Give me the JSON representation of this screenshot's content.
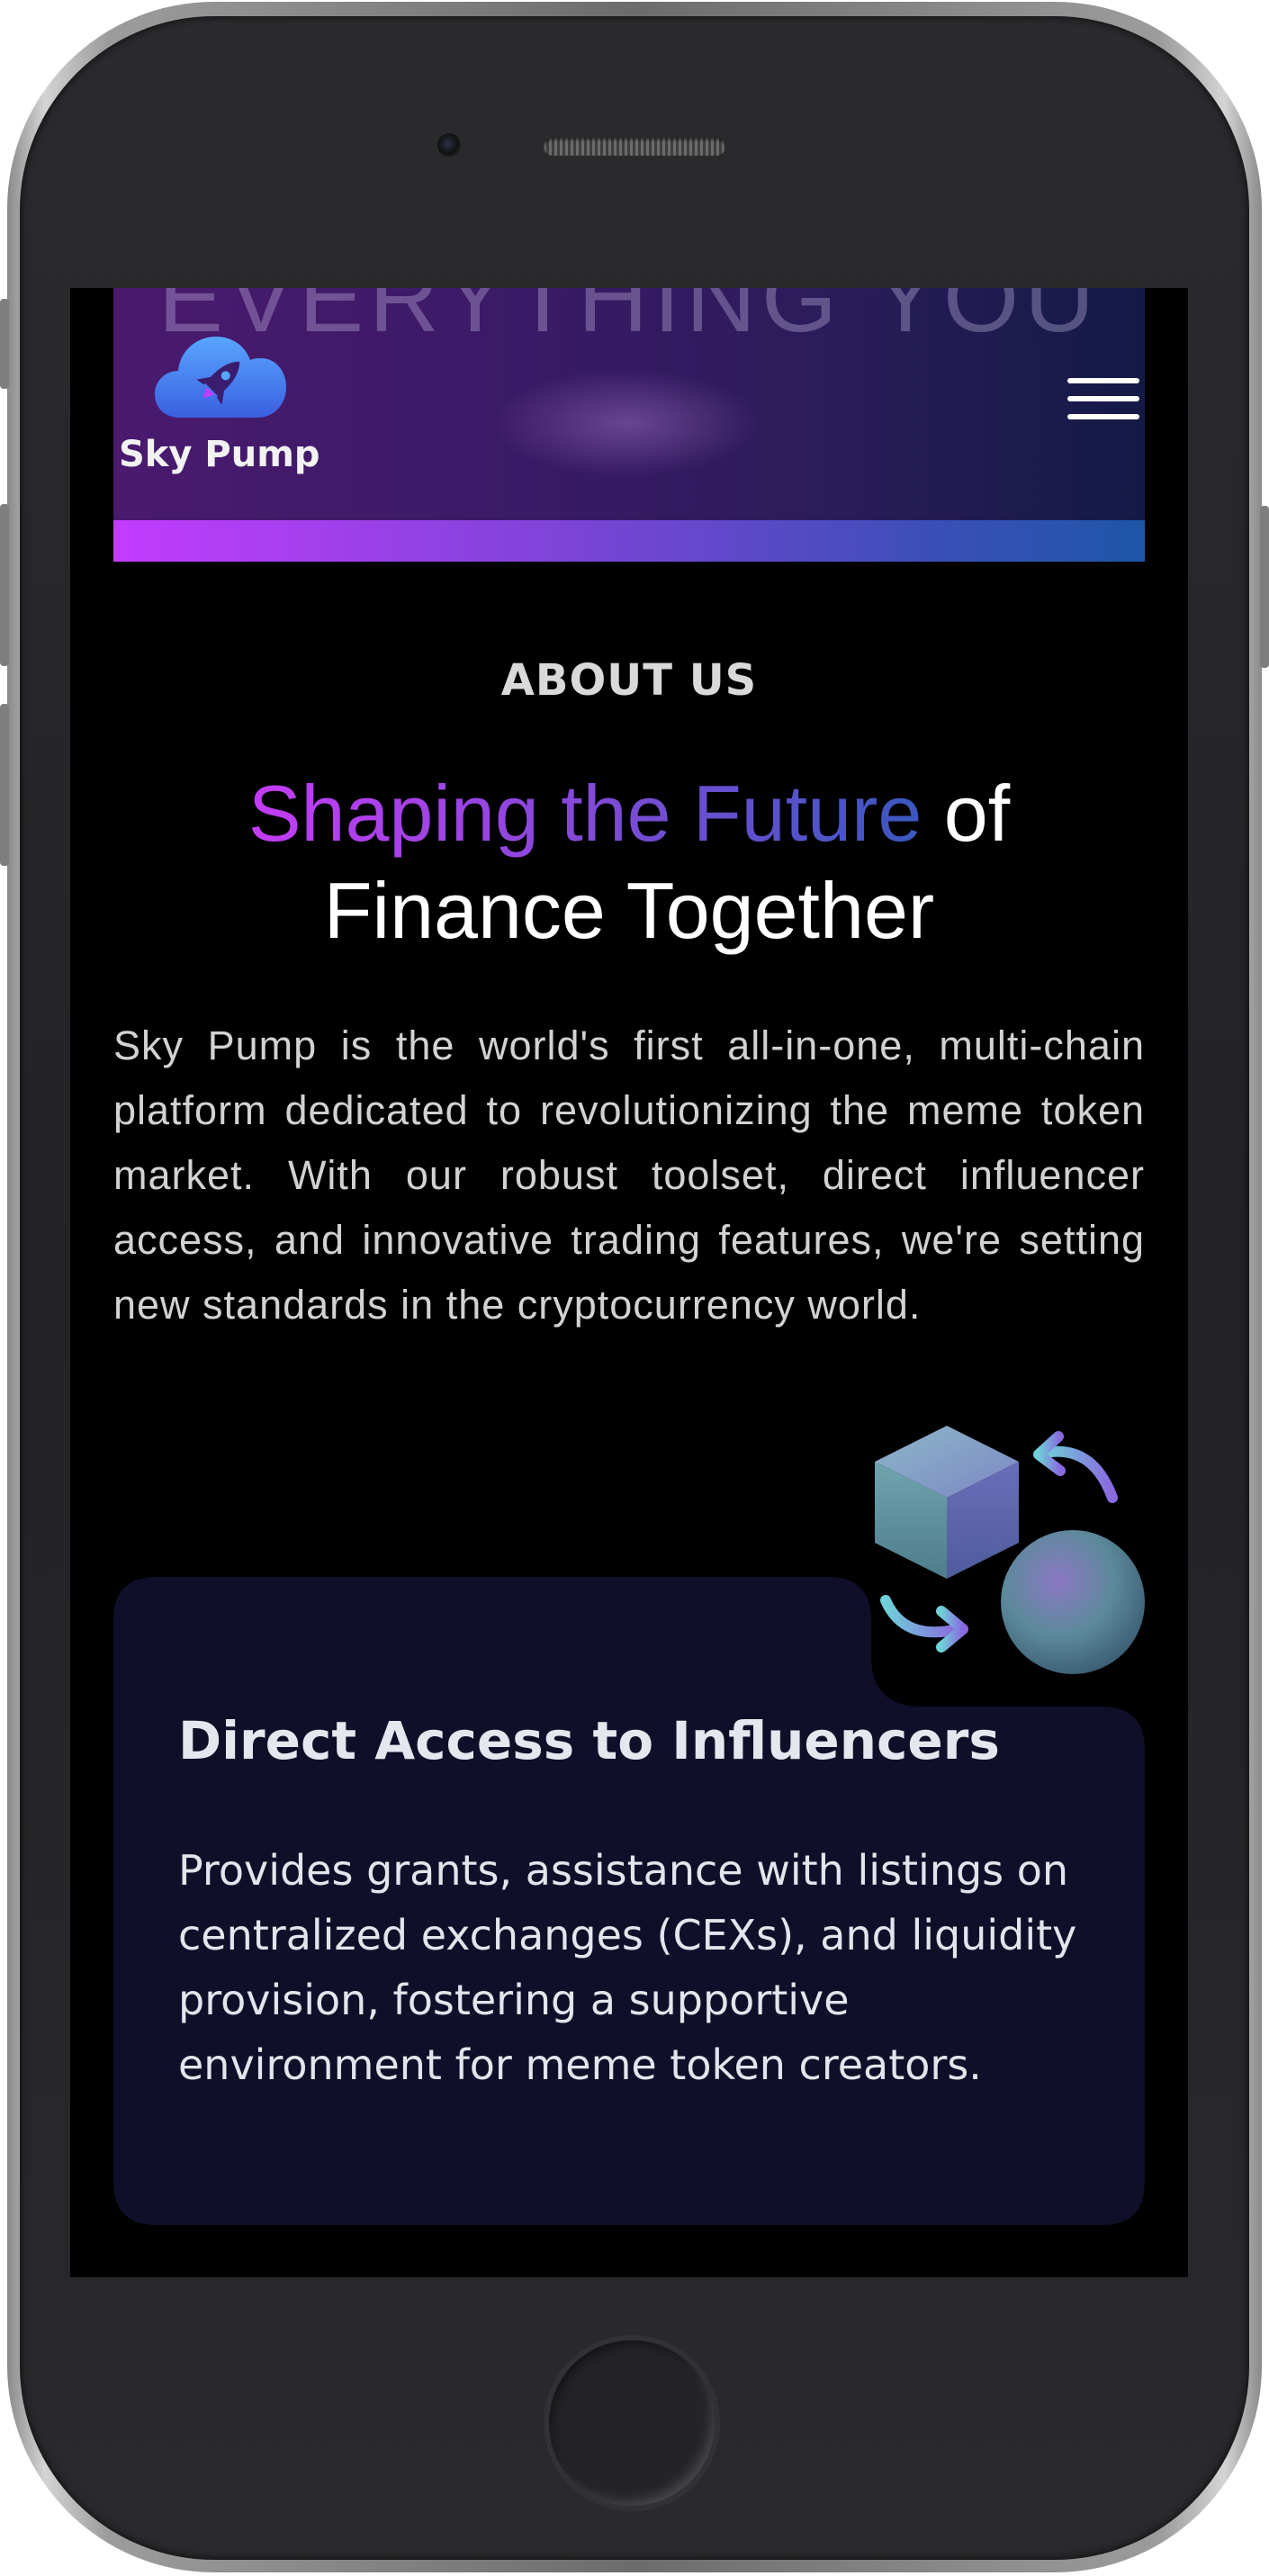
{
  "header": {
    "hero_text": "EVERYTHING YOU",
    "brand_name": "Sky Pump",
    "menu_icon": "hamburger-menu-icon",
    "logo_icon": "cloud-rocket-icon"
  },
  "about": {
    "label": "ABOUT US",
    "heading_highlight": "Shaping the Future",
    "heading_rest_1": " of",
    "heading_rest_2": "Finance Together",
    "paragraph": "Sky Pump is the world's first all-in-one, multi-chain platform dedicated to revolutionizing the meme token market. With our robust toolset, direct influencer access, and innovative trading features, we're setting new standards in the cryptocurrency world."
  },
  "feature_card": {
    "title": "Direct Access to Influencers",
    "body": "Provides grants, assistance with listings on centralized exchanges (CEXs), and liquidity provision, fostering a supportive environment for meme token creators.",
    "illustration_icon": "cube-sphere-exchange-icon"
  },
  "colors": {
    "accent_purple": "#c23cff",
    "accent_blue": "#1e56a8",
    "card_bg": "#0f0f29",
    "screen_bg": "#000000"
  }
}
